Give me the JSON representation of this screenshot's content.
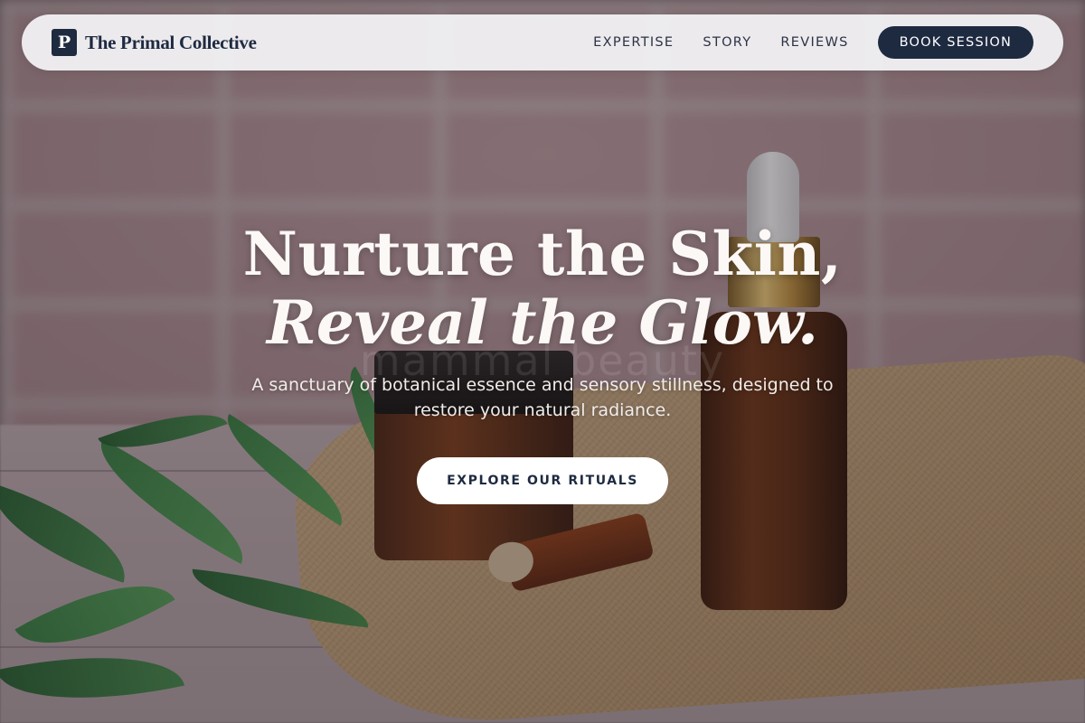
{
  "nav": {
    "logo_letter": "P",
    "brand": "The Primal Collective",
    "links": [
      "EXPERTISE",
      "STORY",
      "REVIEWS"
    ],
    "cta_label": "BOOK SESSION"
  },
  "hero": {
    "headline_line1": "Nurture the Skin,",
    "headline_line2": "Reveal the Glow.",
    "subtext": "A sanctuary of botanical essence and sensory stillness, designed to restore your natural radiance.",
    "cta_label": "EXPLORE OUR RITUALS",
    "watermark": "mammal beauty"
  },
  "colors": {
    "navy": "#1e2a40",
    "nav_bg": "#f4f4f6",
    "white": "#ffffff"
  }
}
